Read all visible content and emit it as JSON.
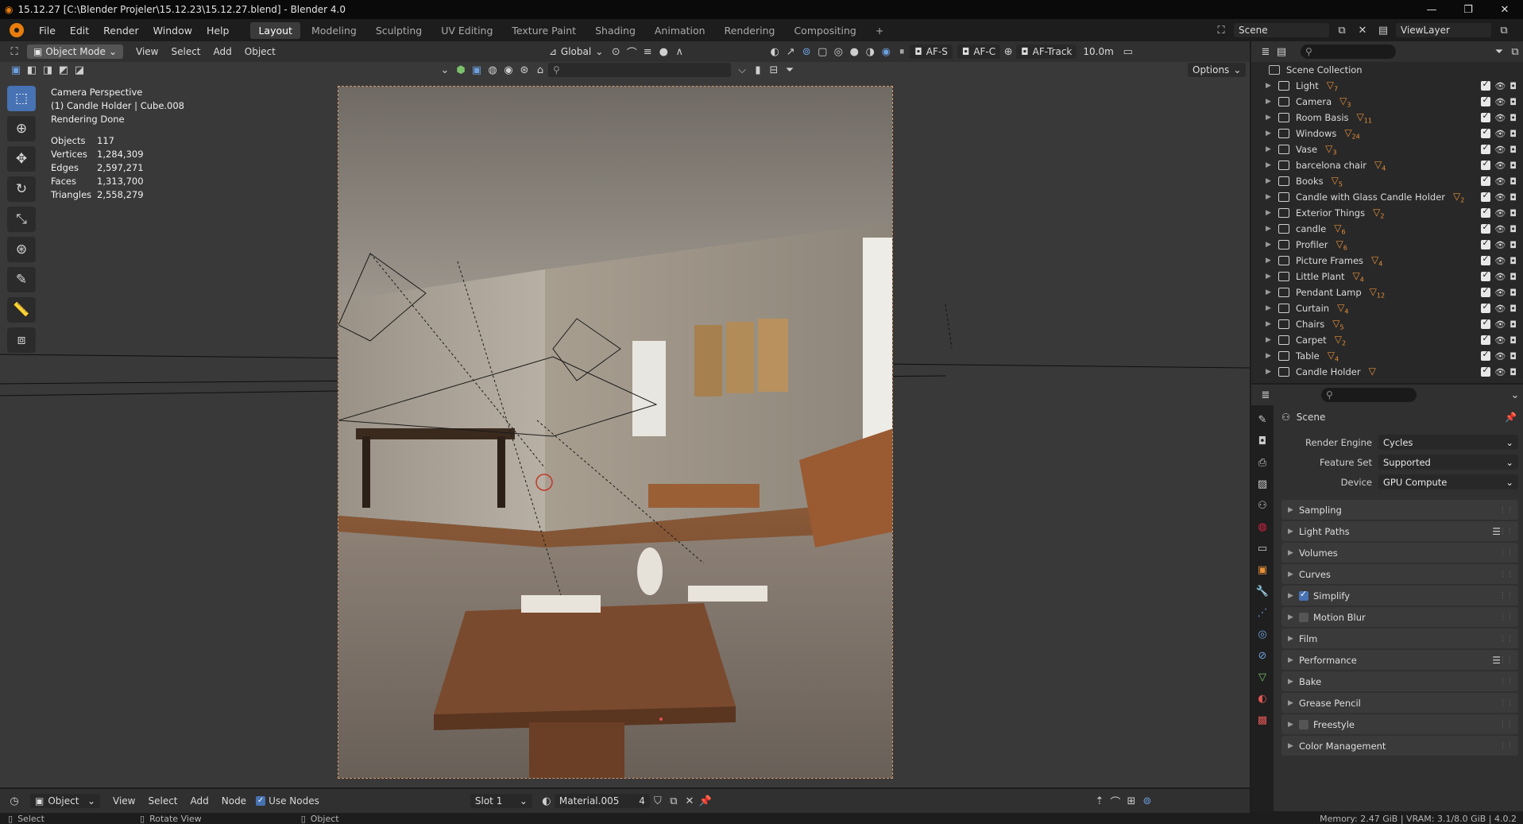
{
  "window": {
    "title": "15.12.27 [C:\\Blender Projeler\\15.12.23\\15.12.27.blend] - Blender 4.0",
    "controls": [
      "—",
      "❐",
      "✕"
    ]
  },
  "menubar": {
    "menus": [
      "File",
      "Edit",
      "Render",
      "Window",
      "Help"
    ],
    "workspaces": [
      "Layout",
      "Modeling",
      "Sculpting",
      "UV Editing",
      "Texture Paint",
      "Shading",
      "Animation",
      "Rendering",
      "Compositing"
    ],
    "active_workspace": "Layout",
    "add_workspace": "+",
    "scene_label": "Scene",
    "view_layer_label": "ViewLayer"
  },
  "viewport_header": {
    "mode": "Object Mode",
    "menus": [
      "View",
      "Select",
      "Add",
      "Object"
    ],
    "orientation": "Global",
    "af_s": "AF-S",
    "af_c": "AF-C",
    "af_track": "AF-Track",
    "distance": "10.0m",
    "options": "Options"
  },
  "overlay_stats": {
    "camera": "Camera Perspective",
    "object": "(1) Candle Holder | Cube.008",
    "status": "Rendering Done",
    "rows": [
      {
        "k": "Objects",
        "v": "117"
      },
      {
        "k": "Vertices",
        "v": "1,284,309"
      },
      {
        "k": "Edges",
        "v": "2,597,271"
      },
      {
        "k": "Faces",
        "v": "1,313,700"
      },
      {
        "k": "Triangles",
        "v": "2,558,279"
      }
    ]
  },
  "tools": [
    "select-box",
    "cursor",
    "move",
    "rotate",
    "scale",
    "transform",
    "annotate",
    "measure",
    "add-cube"
  ],
  "outliner": {
    "root": "Scene Collection",
    "items": [
      {
        "label": "Light",
        "badge": "7"
      },
      {
        "label": "Camera",
        "badge": "3"
      },
      {
        "label": "Room Basis",
        "badge": "11"
      },
      {
        "label": "Windows",
        "badge": "24"
      },
      {
        "label": "Vase",
        "badge": "3"
      },
      {
        "label": "barcelona chair",
        "badge": "4"
      },
      {
        "label": "Books",
        "badge": "5"
      },
      {
        "label": "Candle with Glass Candle Holder",
        "badge": "2"
      },
      {
        "label": "Exterior Things",
        "badge": "2"
      },
      {
        "label": "candle",
        "badge": "6"
      },
      {
        "label": "Profiler",
        "badge": "6"
      },
      {
        "label": "Picture Frames",
        "badge": "4"
      },
      {
        "label": "Little Plant",
        "badge": "4"
      },
      {
        "label": "Pendant Lamp",
        "badge": "12"
      },
      {
        "label": "Curtain",
        "badge": "4"
      },
      {
        "label": "Chairs",
        "badge": "5"
      },
      {
        "label": "Carpet",
        "badge": "2"
      },
      {
        "label": "Table",
        "badge": "4"
      },
      {
        "label": "Candle Holder",
        "badge": ""
      }
    ]
  },
  "properties": {
    "context": "Scene",
    "render_engine": {
      "label": "Render Engine",
      "value": "Cycles"
    },
    "feature_set": {
      "label": "Feature Set",
      "value": "Supported"
    },
    "device": {
      "label": "Device",
      "value": "GPU Compute"
    },
    "panels": [
      {
        "label": "Sampling",
        "checkbox": null,
        "list": false
      },
      {
        "label": "Light Paths",
        "checkbox": null,
        "list": true
      },
      {
        "label": "Volumes",
        "checkbox": null,
        "list": false
      },
      {
        "label": "Curves",
        "checkbox": null,
        "list": false
      },
      {
        "label": "Simplify",
        "checkbox": true,
        "list": false
      },
      {
        "label": "Motion Blur",
        "checkbox": false,
        "list": false
      },
      {
        "label": "Film",
        "checkbox": null,
        "list": false
      },
      {
        "label": "Performance",
        "checkbox": null,
        "list": true
      },
      {
        "label": "Bake",
        "checkbox": null,
        "list": false
      },
      {
        "label": "Grease Pencil",
        "checkbox": null,
        "list": false
      },
      {
        "label": "Freestyle",
        "checkbox": false,
        "list": false
      },
      {
        "label": "Color Management",
        "checkbox": null,
        "list": false
      }
    ]
  },
  "node_header": {
    "editor": "Object",
    "menus": [
      "View",
      "Select",
      "Add",
      "Node"
    ],
    "use_nodes": "Use Nodes",
    "slot": "Slot 1",
    "material": "Material.005",
    "users": "4"
  },
  "statusbar": {
    "left": [
      "Select",
      "Rotate View",
      "Object"
    ],
    "right": "Memory: 2.47 GiB | VRAM: 3.1/8.0 GiB | 4.0.2"
  },
  "colors": {
    "accent": "#4772b3",
    "orange": "#e8903a",
    "bg": "#1d1d1d",
    "panel": "#303030"
  }
}
